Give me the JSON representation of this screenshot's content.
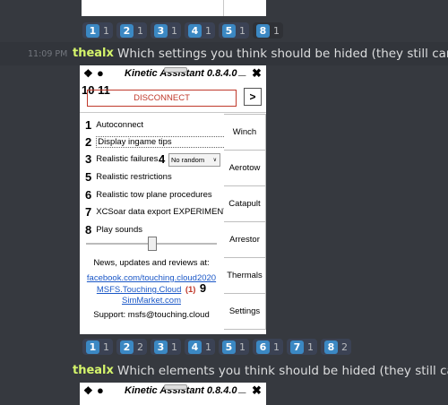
{
  "top_reactions": [
    {
      "emoji": "1",
      "count": "1"
    },
    {
      "emoji": "2",
      "count": "1"
    },
    {
      "emoji": "3",
      "count": "1"
    },
    {
      "emoji": "4",
      "count": "1"
    },
    {
      "emoji": "5",
      "count": "1"
    },
    {
      "emoji": "8",
      "count": "1"
    }
  ],
  "message1": {
    "time": "11:09 PM",
    "author": "thealx",
    "text": "Which settings you think should be hided (they still can"
  },
  "window1": {
    "title": "Kinetic Assistant 0.8.4.0",
    "pin": "📌",
    "dot": "●",
    "min": "_",
    "close": "✖",
    "label_10_11": "10 11",
    "disconnect": "DISCONNECT",
    "next": ">",
    "options": [
      {
        "num": "1",
        "label": "Autoconnect"
      },
      {
        "num": "2",
        "label": "Display ingame tips"
      },
      {
        "num": "3",
        "label": "Realistic failures"
      },
      {
        "num": "5",
        "label": "Realistic restrictions"
      },
      {
        "num": "6",
        "label": "Realistic tow plane procedures"
      },
      {
        "num": "7",
        "label": "XCSoar data export EXPERIMENT."
      },
      {
        "num": "8",
        "label": "Play sounds"
      }
    ],
    "num4": "4",
    "failure_select": "No random",
    "side_buttons": [
      "Winch",
      "Aerotow",
      "Catapult",
      "Arrestor",
      "Thermals",
      "Settings"
    ],
    "news": "News, updates and reviews at:",
    "link_facebook": "facebook.com/touching.cloud2020",
    "link_msfs": "MSFS.Touching.Cloud",
    "msfs_count": "(1)",
    "num9": "9",
    "link_simmarket": "SimMarket.com",
    "support": "Support: msfs@touching.cloud"
  },
  "bottom_reactions": [
    {
      "emoji": "1",
      "count": "1"
    },
    {
      "emoji": "2",
      "count": "2"
    },
    {
      "emoji": "3",
      "count": "1"
    },
    {
      "emoji": "4",
      "count": "1"
    },
    {
      "emoji": "5",
      "count": "1"
    },
    {
      "emoji": "6",
      "count": "1"
    },
    {
      "emoji": "7",
      "count": "1"
    },
    {
      "emoji": "8",
      "count": "2"
    }
  ],
  "message2": {
    "author": "thealx",
    "text": "Which elements you think should be hided (they still can"
  },
  "window2": {
    "title": "Kinetic Assistant 0.8.4.0",
    "pin": "📌",
    "dot": "●",
    "min": "_",
    "close": "✖"
  },
  "colors": {
    "background": "#36393f",
    "author": "#d5f56b",
    "emoji_blue": "#3b88c3",
    "link": "#1a57c7",
    "disconnect_border": "#c0392b"
  }
}
